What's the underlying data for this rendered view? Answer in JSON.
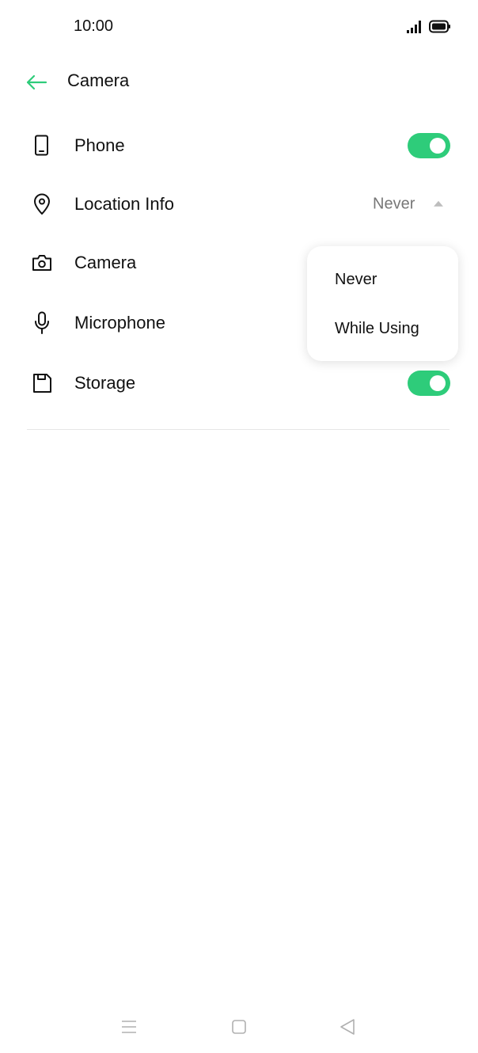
{
  "status_bar": {
    "time": "10:00",
    "signal_icon": "signal-icon",
    "battery_icon": "battery-icon"
  },
  "header": {
    "back_icon": "arrow-left-icon",
    "title": "Camera"
  },
  "colors": {
    "accent": "#2ecc7a",
    "back_arrow": "#2ecc7a",
    "text_primary": "#111111",
    "text_secondary": "#777777",
    "divider": "#e6e6e6"
  },
  "permissions": [
    {
      "label": "Phone",
      "icon": "phone-icon",
      "control": "toggle",
      "enabled": true
    },
    {
      "label": "Location Info",
      "icon": "location-pin-icon",
      "control": "dropdown",
      "value": "Never",
      "expanded": true
    },
    {
      "label": "Camera",
      "icon": "camera-icon",
      "control": "none"
    },
    {
      "label": "Microphone",
      "icon": "microphone-icon",
      "control": "none"
    },
    {
      "label": "Storage",
      "icon": "storage-icon",
      "control": "toggle",
      "enabled": true
    }
  ],
  "popup_menu": {
    "options": [
      "Never",
      "While Using"
    ]
  },
  "nav_bar": {
    "menu_icon": "menu-icon",
    "home_icon": "home-icon",
    "back_icon": "back-triangle-icon"
  }
}
